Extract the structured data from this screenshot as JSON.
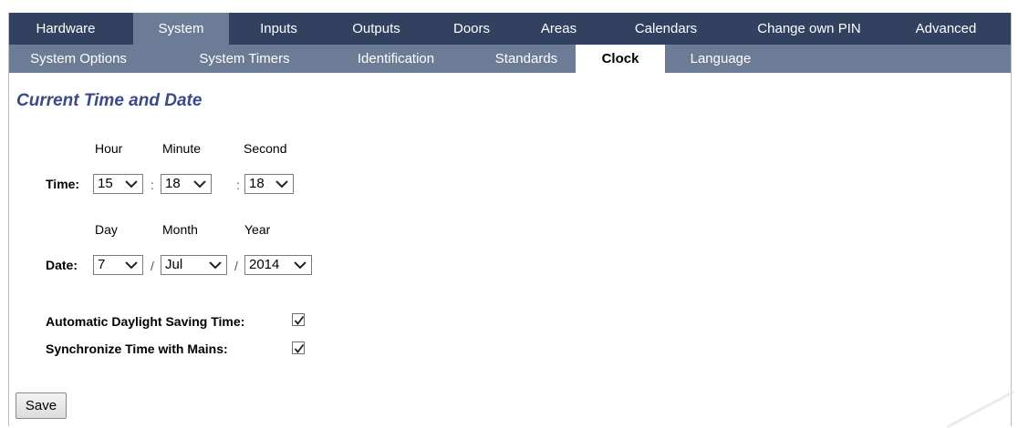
{
  "nav_primary": [
    {
      "label": "Hardware"
    },
    {
      "label": "System",
      "active": true
    },
    {
      "label": "Inputs"
    },
    {
      "label": "Outputs"
    },
    {
      "label": "Doors"
    },
    {
      "label": "Areas"
    },
    {
      "label": "Calendars"
    },
    {
      "label": "Change own PIN"
    },
    {
      "label": "Advanced"
    }
  ],
  "nav_secondary": [
    {
      "label": "System Options"
    },
    {
      "label": "System Timers"
    },
    {
      "label": "Identification"
    },
    {
      "label": "Standards"
    },
    {
      "label": "Clock",
      "active": true
    },
    {
      "label": "Language"
    }
  ],
  "section_title": "Current Time and Date",
  "time": {
    "label": "Time:",
    "hour_label": "Hour",
    "minute_label": "Minute",
    "second_label": "Second",
    "hour": "15",
    "minute": "18",
    "second": "18",
    "sep": ":"
  },
  "date": {
    "label": "Date:",
    "day_label": "Day",
    "month_label": "Month",
    "year_label": "Year",
    "day": "7",
    "month": "Jul",
    "year": "2014",
    "sep": "/"
  },
  "options": {
    "dst_label": "Automatic Daylight Saving Time:",
    "dst_checked": true,
    "sync_label": "Synchronize Time with Mains:",
    "sync_checked": true
  },
  "save_label": "Save",
  "colors": {
    "nav_primary_bg": "#32415f",
    "nav_secondary_bg": "#6c7c97",
    "title": "#3b4a85"
  },
  "icons": {
    "dropdown": "chevron-down-icon",
    "checkbox": "checkmark-icon"
  }
}
